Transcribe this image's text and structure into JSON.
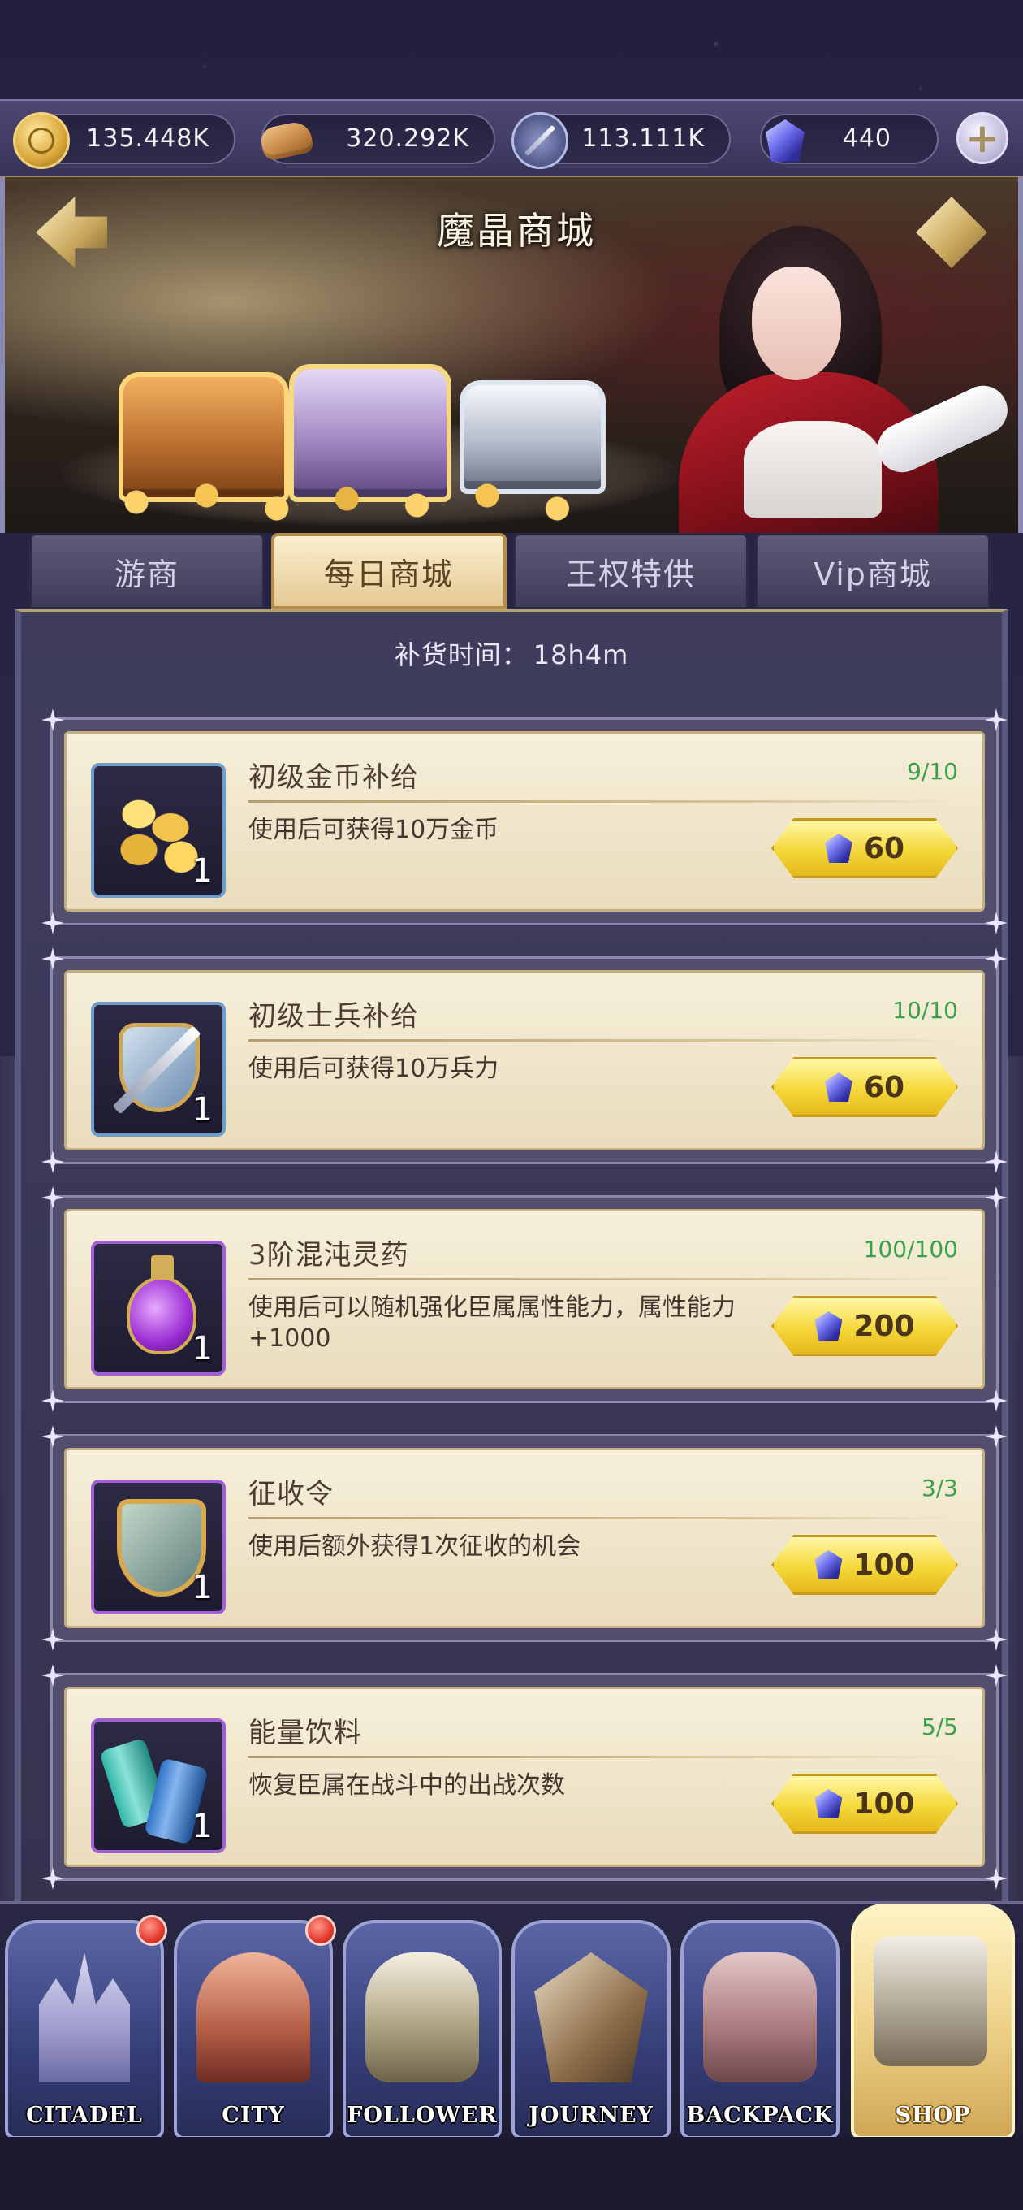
{
  "resources": [
    {
      "name": "gold",
      "icon": "gold-coin-icon",
      "value": "135.448K"
    },
    {
      "name": "food",
      "icon": "bread-icon",
      "value": "320.292K"
    },
    {
      "name": "troops",
      "icon": "sword-icon",
      "value": "113.111K"
    },
    {
      "name": "crystal",
      "icon": "crystal-gem-icon",
      "value": "440"
    }
  ],
  "add_button_label": "+",
  "banner": {
    "title": "魔晶商城"
  },
  "tabs": [
    {
      "label": "游商",
      "active": false
    },
    {
      "label": "每日商城",
      "active": true
    },
    {
      "label": "王权特供",
      "active": false
    },
    {
      "label": "Vip商城",
      "active": false
    }
  ],
  "restock": {
    "label": "补货时间：",
    "value": "18h4m"
  },
  "items": [
    {
      "name": "初级金币补给",
      "desc": "使用后可获得10万金币",
      "limit": "9/10",
      "qty": "1",
      "price": "60",
      "icon": "gold-coins-icon"
    },
    {
      "name": "初级士兵补给",
      "desc": "使用后可获得10万兵力",
      "limit": "10/10",
      "qty": "1",
      "price": "60",
      "icon": "sword-shield-icon"
    },
    {
      "name": "3阶混沌灵药",
      "desc": "使用后可以随机强化臣属属性能力，属性能力+1000",
      "limit": "100/100",
      "qty": "1",
      "price": "200",
      "icon": "potion-icon"
    },
    {
      "name": "征收令",
      "desc": "使用后额外获得1次征收的机会",
      "limit": "3/3",
      "qty": "1",
      "price": "100",
      "icon": "badge-icon"
    },
    {
      "name": "能量饮料",
      "desc": "恢复臣属在战斗中的出战次数",
      "limit": "5/5",
      "qty": "1",
      "price": "100",
      "icon": "energy-drink-icon"
    }
  ],
  "nav": [
    {
      "label": "CITADEL",
      "icon": "castle-icon",
      "notify": true
    },
    {
      "label": "CITY",
      "icon": "city-gate-icon",
      "notify": true
    },
    {
      "label": "FOLLOWER",
      "icon": "helmet-icon",
      "notify": false
    },
    {
      "label": "JOURNEY",
      "icon": "crossed-swords-icon",
      "notify": false
    },
    {
      "label": "BACKPACK",
      "icon": "backpack-icon",
      "notify": false
    },
    {
      "label": "SHOP",
      "icon": "shop-chest-icon",
      "notify": false,
      "active": true
    }
  ],
  "colors": {
    "limit_green": "#3aa04a",
    "price_yellow": "#f5d83a",
    "panel_purple": "#3f3c5e",
    "active_tab_gold": "#e4c993"
  }
}
